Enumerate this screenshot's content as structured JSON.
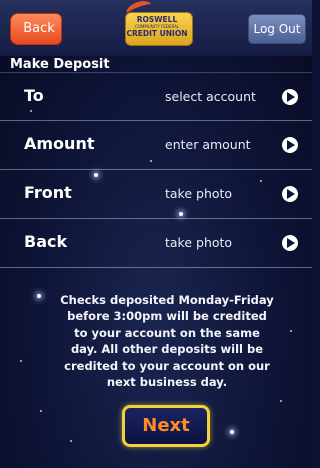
{
  "header": {
    "back_label": "Back",
    "logout_label": "Log Out",
    "logo": {
      "top": "ROSWELL",
      "sub": "COMMUNITY FEDERAL",
      "main": "CREDIT UNION"
    }
  },
  "page_title": "Make Deposit",
  "rows": [
    {
      "label": "To",
      "value": "select account"
    },
    {
      "label": "Amount",
      "value": "enter amount"
    },
    {
      "label": "Front",
      "value": "take photo"
    },
    {
      "label": "Back",
      "value": "take photo"
    }
  ],
  "notice": "Checks deposited Monday-Friday before 3:00pm will be credited to your account on the same day. All other deposits will be credited to your account on our next business day.",
  "next_label": "Next",
  "colors": {
    "back_button": "#e64a1e",
    "logout_button": "#5a6ea6",
    "next_border": "#f2d23c",
    "next_text": "#ff8a2a",
    "background": "#0e1436"
  },
  "icons": {
    "row_arrow": "chevron-right-circle-icon"
  }
}
